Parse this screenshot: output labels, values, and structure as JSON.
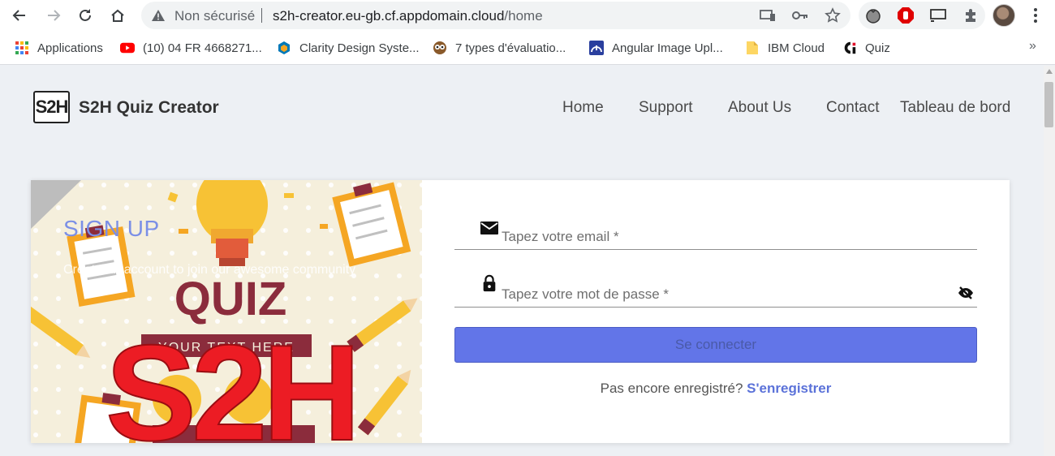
{
  "browser": {
    "security_label": "Non sécurisé",
    "url_host": "s2h-creator.eu-gb.cf.appdomain.cloud",
    "url_path": "/home",
    "bookmarks": [
      {
        "label": "Applications"
      },
      {
        "label": "(10) 04 FR 4668271..."
      },
      {
        "label": "Clarity Design Syste..."
      },
      {
        "label": "7 types d'évaluatio..."
      },
      {
        "label": "Angular Image Upl..."
      },
      {
        "label": "IBM Cloud"
      },
      {
        "label": "Quiz"
      }
    ],
    "more_bookmarks": "»"
  },
  "header": {
    "logo_text": "S2H",
    "brand": "S2H Quiz Creator",
    "nav": [
      "Home",
      "Support",
      "About Us",
      "Contact",
      "Tableau de bord"
    ]
  },
  "hero": {
    "title": "SIGN UP",
    "subtitle": "Create an account to join our awesome community",
    "image_text": "QUIZ",
    "image_banner": "YOUR TEXT HERE",
    "overlay_text": "S2H"
  },
  "login_form": {
    "email_placeholder": "Tapez votre email *",
    "password_placeholder": "Tapez votre mot de passe *",
    "submit_label": "Se connecter",
    "register_prompt": "Pas encore enregistré?",
    "register_link": "S'enregistrer"
  },
  "colors": {
    "primary_button": "#6275e8",
    "link": "#5b72d9",
    "overlay_red": "#ec1c24",
    "page_background": "#edf0f4"
  },
  "icons": [
    "back-icon",
    "forward-icon",
    "reload-icon",
    "home-icon",
    "warning-icon",
    "cast-icon",
    "key-icon",
    "star-icon",
    "extensions-icon",
    "email-icon",
    "lock-icon",
    "eye-off-icon"
  ]
}
